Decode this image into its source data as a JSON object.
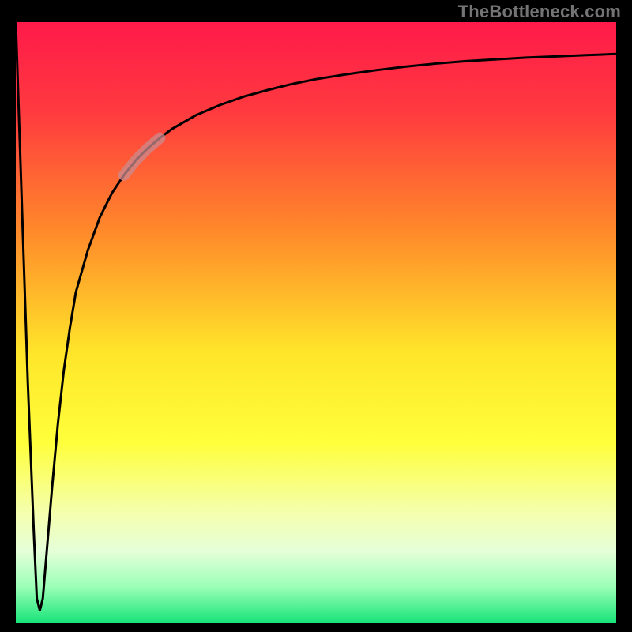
{
  "watermark": "TheBottleneck.com",
  "chart_data": {
    "type": "line",
    "title": "",
    "xlabel": "",
    "ylabel": "",
    "xlim": [
      0,
      100
    ],
    "ylim": [
      0,
      100
    ],
    "series": [
      {
        "name": "curve",
        "x": [
          0,
          1,
          2,
          3,
          3.5,
          4,
          4.5,
          5,
          6,
          7,
          8,
          9,
          10,
          12,
          14,
          16,
          18,
          20,
          22,
          24,
          26,
          30,
          34,
          38,
          42,
          46,
          50,
          55,
          60,
          65,
          70,
          75,
          80,
          85,
          90,
          95,
          100
        ],
        "y": [
          100,
          70,
          40,
          15,
          4,
          2,
          4,
          10,
          22,
          33,
          42,
          49,
          55,
          62,
          67.5,
          71.5,
          74.5,
          77,
          79,
          80.7,
          82.2,
          84.5,
          86.2,
          87.6,
          88.7,
          89.7,
          90.5,
          91.3,
          92.0,
          92.6,
          93.1,
          93.5,
          93.8,
          94.1,
          94.3,
          94.5,
          94.7
        ]
      }
    ],
    "highlight": {
      "x_start": 18,
      "x_end": 24
    },
    "gradient_stops": [
      {
        "offset": 0.0,
        "color": "#ff1a4a"
      },
      {
        "offset": 0.15,
        "color": "#ff3a3f"
      },
      {
        "offset": 0.35,
        "color": "#ff8a2a"
      },
      {
        "offset": 0.55,
        "color": "#ffe52a"
      },
      {
        "offset": 0.7,
        "color": "#ffff3a"
      },
      {
        "offset": 0.82,
        "color": "#f4ffb0"
      },
      {
        "offset": 0.88,
        "color": "#e6ffd8"
      },
      {
        "offset": 0.94,
        "color": "#9cffb8"
      },
      {
        "offset": 1.0,
        "color": "#19e47a"
      }
    ],
    "colors": {
      "curve": "#000000",
      "highlight": "#c98b8f",
      "border": "#000000"
    }
  }
}
